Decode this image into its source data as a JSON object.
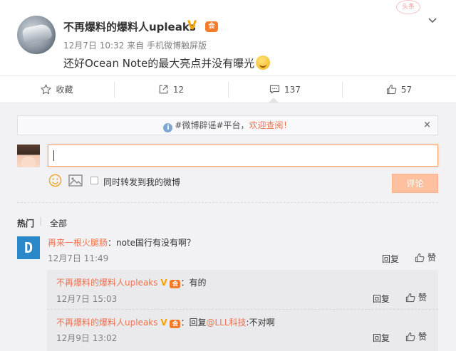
{
  "post": {
    "author": "不再爆料的爆料人upleaks",
    "verified_badge": "V",
    "vip_badge": "会",
    "time": "12月7日 10:32",
    "source_prefix": "来自",
    "source": "手机微博触屏版",
    "text": "还好Ocean Note的最大亮点并没有曝光",
    "menu_icon": "chevron-down-icon",
    "stamp": "头条"
  },
  "actions": {
    "favorite_label": "收藏",
    "repost_count": "12",
    "comment_count": "137",
    "like_count": "57"
  },
  "comment_box": {
    "notice_text": "#微博辟谣#平台，",
    "notice_link": "欢迎查阅！",
    "notice_close": "×",
    "input_value": "",
    "repost_label": "同时转发到我的微博",
    "submit_label": "评论"
  },
  "comment_tabs": {
    "hot": "热门",
    "all": "全部"
  },
  "comments": [
    {
      "avatar_letter": "D",
      "user": "再来一根火腿肠",
      "text": "：note国行有没有啊？",
      "time": "12月7日 11:49",
      "reply_label": "回复",
      "like_label": "赞",
      "replies": [
        {
          "user": "不再爆料的爆料人upleaks",
          "text": "：有的",
          "time": "12月7日 15:03",
          "reply_label": "回复",
          "like_label": "赞"
        },
        {
          "user": "不再爆料的爆料人upleaks",
          "text_prefix": "：回复",
          "mention": "@LLL科技",
          "text_suffix": ":不对啊",
          "time": "12月9日 13:02",
          "reply_label": "回复",
          "like_label": "赞"
        }
      ]
    }
  ],
  "colors": {
    "accent": "#eb7350",
    "submit_disabled": "#ffc09f",
    "verified": "#f7a400"
  }
}
